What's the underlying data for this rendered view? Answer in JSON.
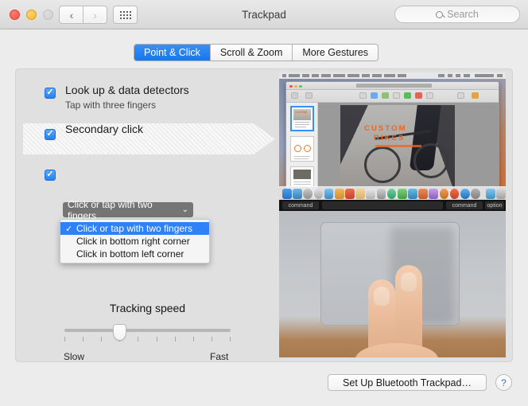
{
  "window": {
    "title": "Trackpad",
    "traffic_lights": [
      "close",
      "minimize",
      "maximize"
    ],
    "nav_back_icon": "chevron-left-icon",
    "nav_forward_icon": "chevron-right-icon",
    "grid_icon": "grid-dots-icon",
    "back_glyph": "‹",
    "forward_glyph": "›",
    "accent_blue": "#1477ef"
  },
  "search": {
    "placeholder": "Search",
    "icon": "search-icon"
  },
  "tabs": [
    {
      "label": "Point & Click",
      "active": true
    },
    {
      "label": "Scroll & Zoom",
      "active": false
    },
    {
      "label": "More Gestures",
      "active": false
    }
  ],
  "options": [
    {
      "title": "Look up & data detectors",
      "subtitle": "Tap with three fingers",
      "checked": true
    },
    {
      "title": "Secondary click",
      "control": "popup",
      "value": "Click or tap with two fingers",
      "checked": true,
      "highlighted": true
    },
    {
      "title": "",
      "subtitle": "",
      "checked": true
    }
  ],
  "popup_menu": {
    "open": true,
    "caret_glyph": "⌄",
    "check_glyph": "✓",
    "items": [
      {
        "label": "Click or tap with two fingers",
        "selected": true
      },
      {
        "label": "Click in bottom right corner",
        "selected": false
      },
      {
        "label": "Click in bottom left corner",
        "selected": false
      }
    ]
  },
  "tracking": {
    "title": "Tracking speed",
    "min_label": "Slow",
    "max_label": "Fast",
    "tick_count": 10,
    "value_index": 3,
    "value_percent": 33
  },
  "preview": {
    "document_headline_line1": "CUSTOM",
    "document_headline_line2": "BIKES",
    "keycaps": [
      "command",
      "command",
      "option"
    ],
    "trackpad_fingers": 2
  },
  "footer": {
    "bluetooth_label": "Set Up Bluetooth Trackpad…",
    "help_label": "?"
  }
}
